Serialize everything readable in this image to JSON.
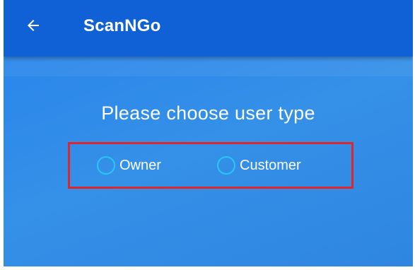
{
  "app_bar": {
    "title": "ScanNGo",
    "back_icon": "arrow-left-icon",
    "background_color": "#1060d6"
  },
  "content": {
    "prompt": "Please choose user type",
    "background_color": "#3590e8",
    "highlight_color": "#e0262d",
    "radio_color": "#27c7f4",
    "user_types": [
      {
        "label": "Owner",
        "selected": false
      },
      {
        "label": "Customer",
        "selected": false
      }
    ]
  }
}
